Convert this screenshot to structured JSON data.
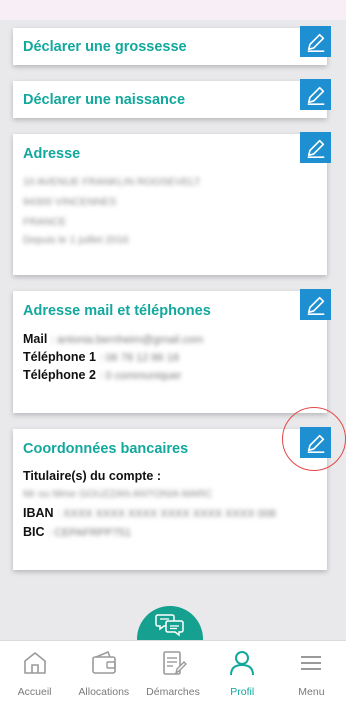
{
  "colors": {
    "accent": "#13a89e",
    "edit_button": "#1e8fd0",
    "highlight_circle": "#e54848",
    "background": "#e9e9ec"
  },
  "cards": {
    "grossesse": {
      "title": "Déclarer une grossesse",
      "icon": "pencil-icon"
    },
    "naissance": {
      "title": "Déclarer une naissance",
      "icon": "pencil-icon"
    },
    "adresse": {
      "title": "Adresse",
      "lines": [
        "10 AVENUE FRANKLIN ROOSEVELT",
        "94300 VINCENNES",
        "FRANCE",
        "Depuis le 1 juillet 2016"
      ]
    },
    "contact": {
      "title": "Adresse mail et téléphones",
      "mail_label": "Mail",
      "mail_value": ": antonia.bernheim@gmail.com",
      "tel1_label": "Téléphone 1",
      "tel1_value": ": 06 78 12 86 18",
      "tel2_label": "Téléphone 2",
      "tel2_value": ": 0 communiquer"
    },
    "bancaire": {
      "title": "Coordonnées bancaires",
      "holder_label": "Titulaire(s) du compte :",
      "holder_value": "Mr ou Mme GOUZZAN ANTONIA MARC",
      "iban_label": "IBAN",
      "iban_value": ": XXXX XXXX XXXX XXXX XXXX XXXX 006",
      "bic_label": "BIC",
      "bic_value": ": CEPAFRPP751"
    }
  },
  "nav": [
    {
      "label": "Accueil",
      "icon": "home-icon"
    },
    {
      "label": "Allocations",
      "icon": "wallet-icon"
    },
    {
      "label": "Démarches",
      "icon": "document-edit-icon"
    },
    {
      "label": "Profil",
      "icon": "person-icon"
    },
    {
      "label": "Menu",
      "icon": "menu-icon"
    }
  ],
  "chat": {
    "icon": "chat-icon"
  }
}
